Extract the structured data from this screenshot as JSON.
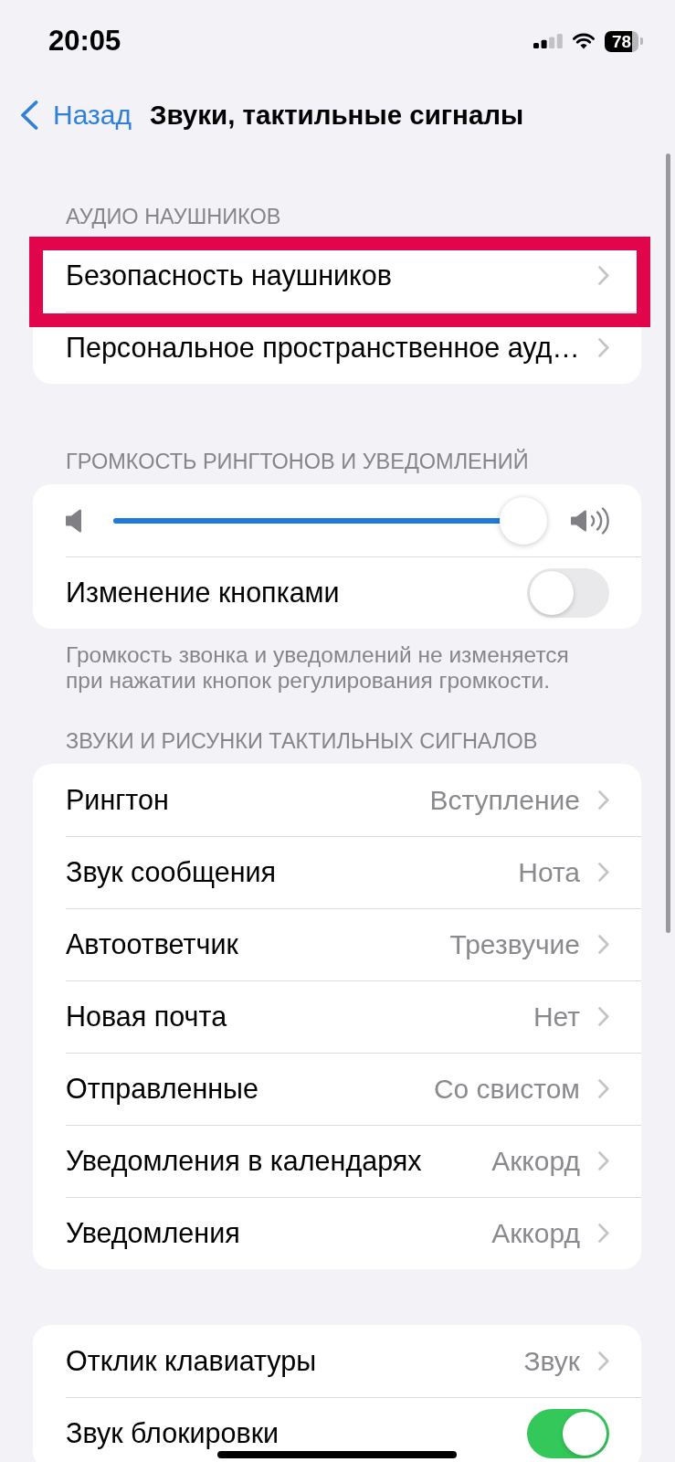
{
  "status_bar": {
    "time": "20:05",
    "battery": "78"
  },
  "nav": {
    "back": "Назад",
    "title": "Звуки, тактильные сигналы"
  },
  "sections": [
    {
      "header": "АУДИО НАУШНИКОВ",
      "rows": [
        {
          "kind": "link",
          "label": "Безопасность наушников",
          "highlighted": true
        },
        {
          "kind": "link",
          "label": "Персональное пространственное ауд…",
          "highlighted": false
        }
      ]
    },
    {
      "header": "ГРОМКОСТЬ РИНГТОНОВ И УВЕДОМЛЕНИЙ",
      "rows": [
        {
          "kind": "slider",
          "level": 1
        },
        {
          "kind": "toggle",
          "label": "Изменение кнопками",
          "on": false
        }
      ],
      "footer": "Громкость звонка и уведомлений не изменяется при нажатии кнопок регулирования громкости."
    },
    {
      "header": "ЗВУКИ И РИСУНКИ ТАКТИЛЬНЫХ СИГНАЛОВ",
      "rows": [
        {
          "kind": "link",
          "label": "Рингтон",
          "value": "Вступление"
        },
        {
          "kind": "link",
          "label": "Звук сообщения",
          "value": "Нота"
        },
        {
          "kind": "link",
          "label": "Автоответчик",
          "value": "Трезвучие"
        },
        {
          "kind": "link",
          "label": "Новая почта",
          "value": "Нет"
        },
        {
          "kind": "link",
          "label": "Отправленные",
          "value": "Со свистом"
        },
        {
          "kind": "link",
          "label": "Уведомления в календарях",
          "value": "Аккорд"
        },
        {
          "kind": "link",
          "label": "Уведомления",
          "value": "Аккорд"
        }
      ]
    },
    {
      "rows": [
        {
          "kind": "link",
          "label": "Отклик клавиатуры",
          "value": "Звук"
        },
        {
          "kind": "toggle",
          "label": "Звук блокировки",
          "on": true
        }
      ]
    }
  ]
}
